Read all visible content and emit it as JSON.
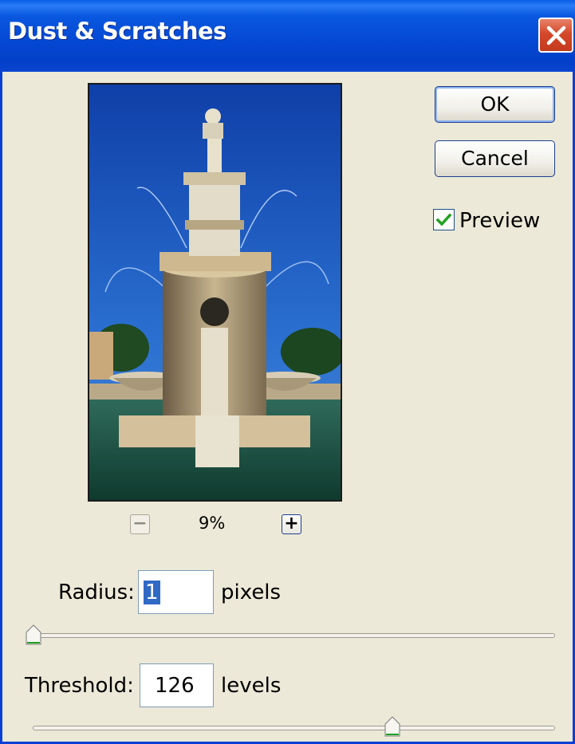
{
  "dialog": {
    "title": "Dust & Scratches",
    "close_icon": "close-icon"
  },
  "buttons": {
    "ok_label": "OK",
    "cancel_label": "Cancel"
  },
  "preview_checkbox": {
    "label": "Preview",
    "checked": true
  },
  "zoom": {
    "level": "9%",
    "minus_label": "−",
    "plus_label": "+"
  },
  "radius": {
    "label": "Radius:",
    "value": "1",
    "unit": "pixels",
    "slider_fraction": 0
  },
  "threshold": {
    "label": "Threshold:",
    "value": "126",
    "unit": "levels",
    "slider_fraction": 0.69
  },
  "colors": {
    "titlebar": "#0447d2",
    "dialog_bg": "#ece9d8",
    "close_button": "#d4482a",
    "selection": "#316ac5",
    "check": "#21a121"
  }
}
